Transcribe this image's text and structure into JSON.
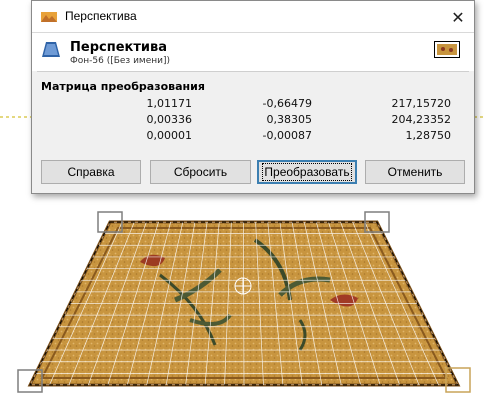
{
  "window": {
    "title": "Перспектива",
    "close_glyph": "✕"
  },
  "header": {
    "tool_title": "Перспектива",
    "subtitle": "Фон-56 ([Без имени])",
    "tool_icon": "perspective-tool-icon",
    "thumb_icon": "image-thumbnail-icon"
  },
  "matrix": {
    "label": "Матрица преобразования",
    "rows": [
      [
        "1,01171",
        "-0,66479",
        "217,15720"
      ],
      [
        "0,00336",
        "0,38305",
        "204,23352"
      ],
      [
        "0,00001",
        "-0,00087",
        "1,28750"
      ]
    ]
  },
  "buttons": {
    "help": "Справка",
    "reset": "Сбросить",
    "transform": "Преобразовать",
    "cancel": "Отменить"
  },
  "colors": {
    "canvas_bg": "#ffffff",
    "carpet_base": "#c8953f",
    "carpet_border": "#8a5a1e",
    "grid": "#ffffff",
    "handle": "#7f7f7f",
    "handle_active": "#c9a458",
    "guide_line": "#c8b000"
  }
}
